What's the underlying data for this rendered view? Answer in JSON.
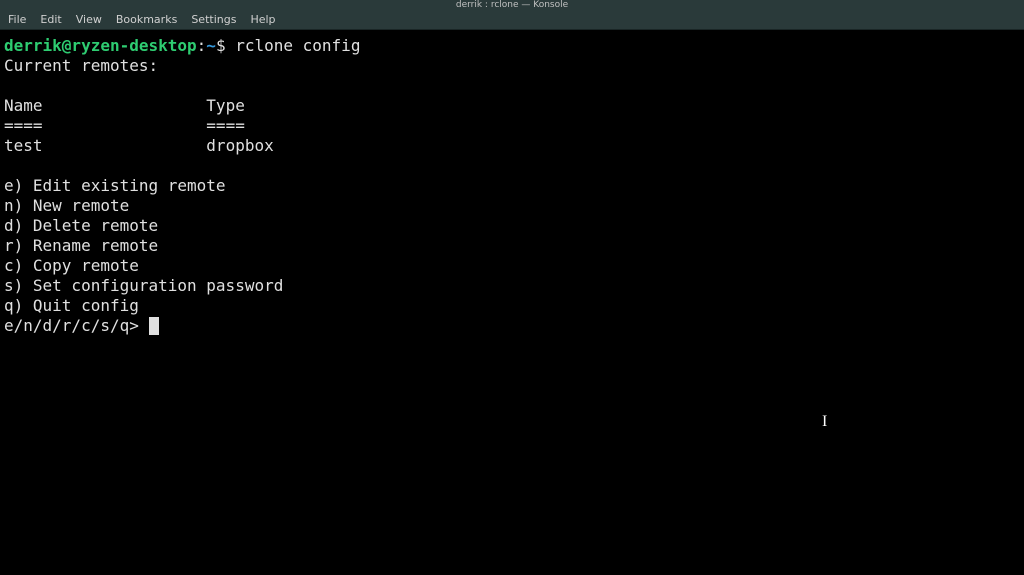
{
  "window": {
    "title": "derrik : rclone — Konsole"
  },
  "menu": {
    "file": "File",
    "edit": "Edit",
    "view": "View",
    "bookmarks": "Bookmarks",
    "settings": "Settings",
    "help": "Help"
  },
  "prompt": {
    "user_host": "derrik@ryzen-desktop",
    "separator": ":",
    "path": "~",
    "symbol": "$",
    "command": "rclone config"
  },
  "output": {
    "line1": "Current remotes:",
    "blank1": "",
    "header_name": "Name",
    "header_type": "Type",
    "rule_name": "====",
    "rule_type": "====",
    "row_name": "test",
    "row_type": "dropbox",
    "blank2": "",
    "opt_e": "e) Edit existing remote",
    "opt_n": "n) New remote",
    "opt_d": "d) Delete remote",
    "opt_r": "r) Rename remote",
    "opt_c": "c) Copy remote",
    "opt_s": "s) Set configuration password",
    "opt_q": "q) Quit config",
    "input_prompt": "e/n/d/r/c/s/q> "
  }
}
